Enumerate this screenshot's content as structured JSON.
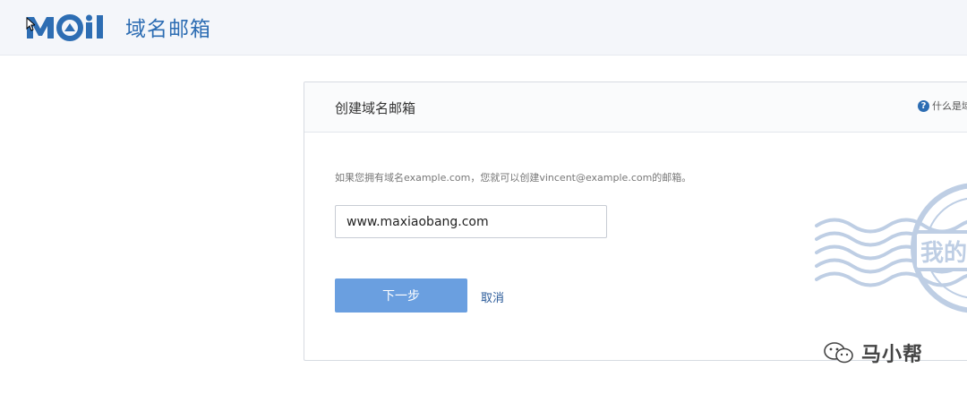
{
  "header": {
    "logo_text": "域名邮箱",
    "logo_mark": "MOIl"
  },
  "panel": {
    "title": "创建域名邮箱",
    "help_text": "什么是域",
    "hint": "如果您拥有域名example.com，您就可以创建vincent@example.com的邮箱。",
    "domain_input_value": "www.maxiaobang.com",
    "next_label": "下一步",
    "cancel_label": "取消",
    "stamp_text": "我的"
  },
  "watermark": {
    "text": "马小帮"
  },
  "colors": {
    "brand": "#2d6db3",
    "button": "#6a9fe0",
    "header_bg": "#f4f6fa"
  }
}
